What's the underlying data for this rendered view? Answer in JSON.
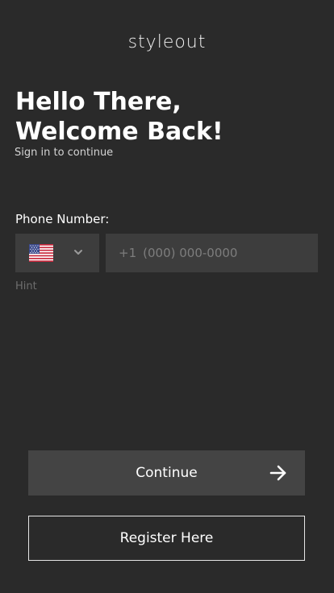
{
  "app": {
    "logo": "styleout"
  },
  "header": {
    "title_line1": "Hello There,",
    "title_line2": "Welcome Back!",
    "subtitle": "Sign in to continue"
  },
  "form": {
    "phone_label": "Phone Number:",
    "country": {
      "selected": "US",
      "flag_icon": "us-flag-icon"
    },
    "phone_prefix": "+1",
    "phone_placeholder": "(000) 000-0000",
    "hint": "Hint"
  },
  "actions": {
    "continue_label": "Continue",
    "register_label": "Register Here"
  },
  "colors": {
    "background": "#2a2a2a",
    "field": "#3d3d3d",
    "button": "#444444",
    "text": "#ffffff",
    "muted": "#7d7d7d"
  }
}
